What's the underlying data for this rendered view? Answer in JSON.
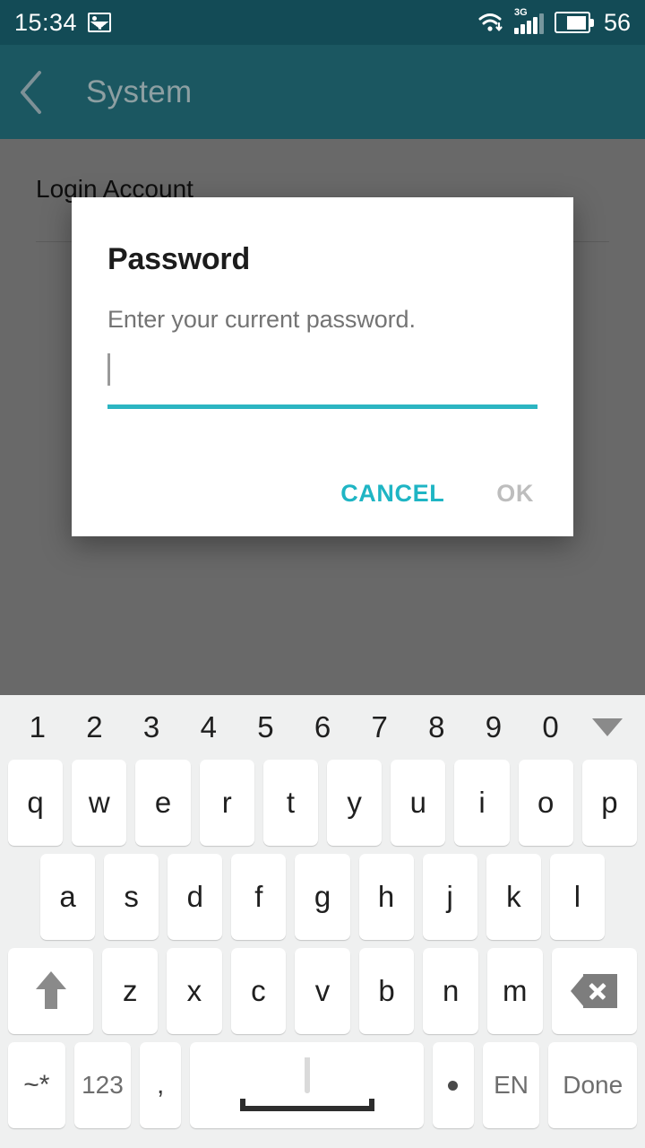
{
  "status_bar": {
    "clock": "15:34",
    "photo_icon": "image-icon",
    "wifi_icon": "wifi-download-icon",
    "network_type": "3G",
    "signal_icon": "signal-bars-icon",
    "battery_icon": "battery-icon",
    "battery_percent": "56"
  },
  "app_bar": {
    "back_icon": "back-chevron-icon",
    "title": "System"
  },
  "content": {
    "section_title": "Login Account"
  },
  "dialog": {
    "title": "Password",
    "message": "Enter your current password.",
    "input_value": "",
    "input_placeholder": "",
    "cancel_label": "CANCEL",
    "ok_label": "OK",
    "accent_color": "#2cb5c2",
    "cancel_color": "#1fb5c4",
    "ok_color": "#bdbdbd"
  },
  "keyboard": {
    "number_row": [
      "1",
      "2",
      "3",
      "4",
      "5",
      "6",
      "7",
      "8",
      "9",
      "0"
    ],
    "hide_icon": "chevron-down-icon",
    "row1": [
      "q",
      "w",
      "e",
      "r",
      "t",
      "y",
      "u",
      "i",
      "o",
      "p"
    ],
    "row2": [
      "a",
      "s",
      "d",
      "f",
      "g",
      "h",
      "j",
      "k",
      "l"
    ],
    "row3": [
      "z",
      "x",
      "c",
      "v",
      "b",
      "n",
      "m"
    ],
    "shift_icon": "shift-arrow-icon",
    "backspace_icon": "backspace-icon",
    "symbols_label": "~*",
    "numeric_label": "123",
    "comma_label": ",",
    "space_icon": "microphone-icon",
    "period_label": "·",
    "language_label": "EN",
    "done_label": "Done"
  }
}
